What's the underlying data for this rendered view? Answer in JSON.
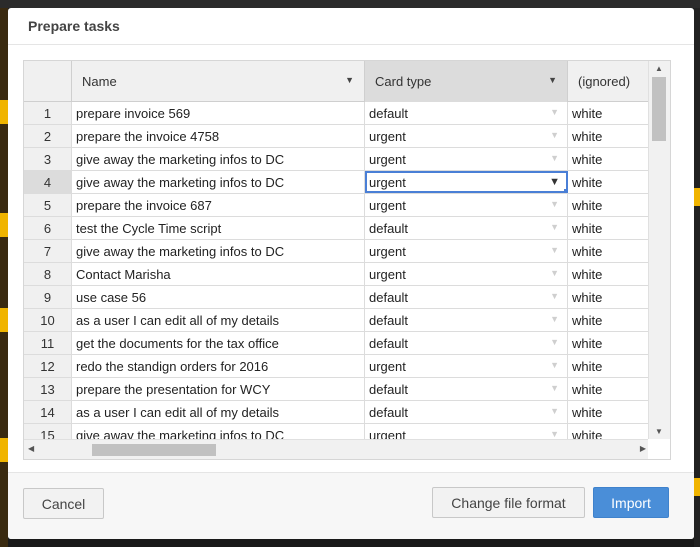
{
  "dialog": {
    "title": "Prepare tasks"
  },
  "grid": {
    "columns": {
      "name": "Name",
      "card_type": "Card type",
      "ignored": "(ignored)"
    },
    "rows": [
      {
        "num": "1",
        "name": "prepare invoice 569",
        "card_type": "default",
        "ignored": "white"
      },
      {
        "num": "2",
        "name": "prepare the invoice 4758",
        "card_type": "urgent",
        "ignored": "white"
      },
      {
        "num": "3",
        "name": "give away the marketing infos to DC",
        "card_type": "urgent",
        "ignored": "white"
      },
      {
        "num": "4",
        "name": "give away the marketing infos to DC",
        "card_type": "urgent",
        "ignored": "white"
      },
      {
        "num": "5",
        "name": "prepare the invoice 687",
        "card_type": "urgent",
        "ignored": "white"
      },
      {
        "num": "6",
        "name": "test the Cycle Time script",
        "card_type": "default",
        "ignored": "white"
      },
      {
        "num": "7",
        "name": "give away the marketing infos to DC",
        "card_type": "urgent",
        "ignored": "white"
      },
      {
        "num": "8",
        "name": "Contact Marisha",
        "card_type": "urgent",
        "ignored": "white"
      },
      {
        "num": "9",
        "name": "use case 56",
        "card_type": "default",
        "ignored": "white"
      },
      {
        "num": "10",
        "name": "as a user I can edit all of my details",
        "card_type": "default",
        "ignored": "white"
      },
      {
        "num": "11",
        "name": "get the documents for the tax office",
        "card_type": "default",
        "ignored": "white"
      },
      {
        "num": "12",
        "name": "redo the standign orders for 2016",
        "card_type": "urgent",
        "ignored": "white"
      },
      {
        "num": "13",
        "name": "prepare the presentation for WCY",
        "card_type": "default",
        "ignored": "white"
      },
      {
        "num": "14",
        "name": "as a user I can edit all of my details",
        "card_type": "default",
        "ignored": "white"
      },
      {
        "num": "15",
        "name": "give away the marketing infos to DC",
        "card_type": "urgent",
        "ignored": "white"
      }
    ],
    "selected_row": "4"
  },
  "footer": {
    "cancel_label": "Cancel",
    "change_format_label": "Change file format",
    "import_label": "Import"
  },
  "colors": {
    "accent": "#4a8ed8",
    "selection": "#4a7fd6",
    "header_bg": "#f0f0f0"
  },
  "icons": {
    "sort": "triangle-down-icon",
    "dropdown": "triangle-down-icon"
  }
}
